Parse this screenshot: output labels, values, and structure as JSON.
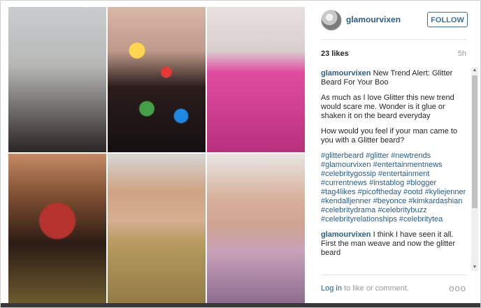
{
  "post": {
    "username": "glamourvixen",
    "follow_label": "FOLLOW",
    "likes": "23 likes",
    "time": "5h",
    "caption": {
      "username": "glamourvixen",
      "title": "New Trend Alert: Glitter Beard For Your Boo",
      "paragraph1": "As much as I love Glitter this new trend would scare me. Wonder is it glue or shaken it on the beard everyday",
      "paragraph2": "How would you feel if your man came to you with a Glitter beard?",
      "hashtags": "#glitterbeard #glitter #newtrends #glamourvixen #entertainmentnews #celebritygossip #entertainment #currentnews #instablog #blogger #tag4likes #picoftheday #ootd #kyliejenner #kendalljenner #beyonce #kimkardashian #celebritydrama #celebritybuzz #celebrityrelationships #celebritytea"
    },
    "comment": {
      "username": "glamourvixen",
      "text": "I think I have seen it all. First the man weave and now the glitter beard"
    },
    "footer": {
      "login_link": "Log in",
      "login_suffix": " to like or comment.",
      "more": "ooo"
    }
  },
  "icons": {
    "scroll_up": "▲",
    "scroll_down": "▼"
  }
}
